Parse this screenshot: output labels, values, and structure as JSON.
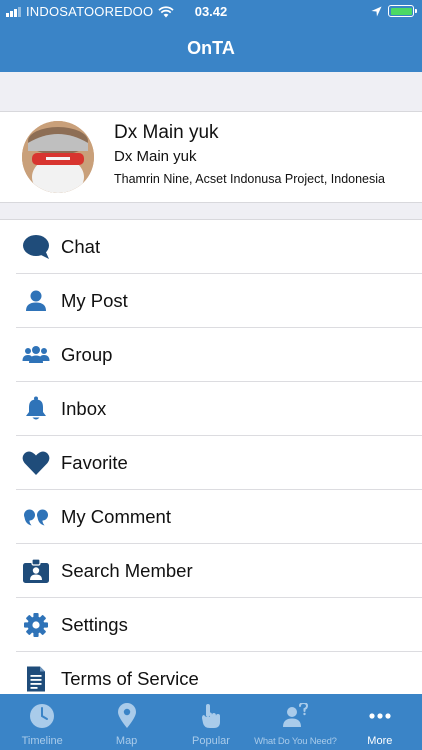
{
  "status_bar": {
    "carrier": "INDOSATOOREDOO",
    "time": "03.42",
    "icons": [
      "signal-icon",
      "wifi-icon",
      "location-arrow-icon",
      "battery-icon"
    ]
  },
  "header": {
    "title": "OnTA"
  },
  "profile": {
    "name": "Dx Main yuk",
    "subtitle": "Dx Main yuk",
    "location": "Thamrin Nine, Acset Indonusa Project, Indonesia"
  },
  "menu": {
    "items": [
      {
        "label": "Chat",
        "icon": "chat-bubble-icon"
      },
      {
        "label": "My Post",
        "icon": "user-icon"
      },
      {
        "label": "Group",
        "icon": "group-icon"
      },
      {
        "label": "Inbox",
        "icon": "bell-icon"
      },
      {
        "label": "Favorite",
        "icon": "heart-icon"
      },
      {
        "label": "My Comment",
        "icon": "quote-icon"
      },
      {
        "label": "Search Member",
        "icon": "id-badge-icon"
      },
      {
        "label": "Settings",
        "icon": "gear-icon"
      },
      {
        "label": "Terms of Service",
        "icon": "document-icon"
      }
    ]
  },
  "tab_bar": {
    "tabs": [
      {
        "label": "Timeline",
        "icon": "clock-icon",
        "active": false
      },
      {
        "label": "Map",
        "icon": "map-pin-icon",
        "active": false
      },
      {
        "label": "Popular",
        "icon": "pointing-hand-icon",
        "active": false
      },
      {
        "label": "What Do You Need?",
        "icon": "user-question-icon",
        "active": false
      },
      {
        "label": "More",
        "icon": "more-dots-icon",
        "active": true
      }
    ]
  },
  "colors": {
    "brand_blue": "#3a84c7",
    "icon_blue": "#2f73b8",
    "icon_navy": "#1f4c7a",
    "tab_inactive": "#a9cbea",
    "separator_bg": "#efeff4"
  }
}
